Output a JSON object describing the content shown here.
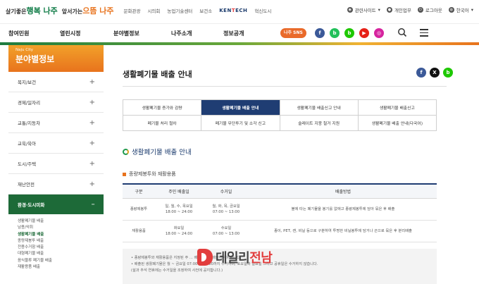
{
  "header": {
    "logo": {
      "part1": "살기좋은",
      "part2": "행복 나주",
      "part3": "앞서가는",
      "part4": "으뜸 나주"
    },
    "links": [
      "문화관광",
      "시의회",
      "농업기술센터",
      "보건소"
    ],
    "kentech": "KENTECH",
    "links2": [
      "혁신도시"
    ],
    "utils": [
      "관련사이트",
      "개인업무",
      "로그아웃",
      "한국어"
    ]
  },
  "nav": {
    "menus": [
      "참여민원",
      "열린시정",
      "분야별정보",
      "나주소개",
      "정보공개"
    ],
    "sns_label": "나주 SNS",
    "sns_icons": [
      {
        "name": "facebook-icon",
        "glyph": "f",
        "color": "#3b5998"
      },
      {
        "name": "band-icon",
        "glyph": "b",
        "color": "#21c05a"
      },
      {
        "name": "blog-icon",
        "glyph": "b",
        "color": "#1ec800"
      },
      {
        "name": "youtube-icon",
        "glyph": "▶",
        "color": "#e62117"
      },
      {
        "name": "instagram-icon",
        "glyph": "◎",
        "color": "#d6249f"
      },
      {
        "name": "kakaostory-icon",
        "glyph": "●",
        "color": "#f5c300"
      }
    ]
  },
  "sidebar": {
    "subtitle": "Naju City",
    "title": "분야별정보",
    "items": [
      "복지/보건",
      "경제/일자리",
      "교통/지동차",
      "교육/육아",
      "도시/주택",
      "재난안전"
    ],
    "active": "환경·도시미화",
    "subitems": [
      "생활폐기물 배출",
      "남용/악취",
      "생활폐기물 배출",
      "종량제봉투 배출",
      "전용수거함 배출",
      "대형폐기물 배출",
      "음식물류 폐기물 배출",
      "재활용품 배출"
    ]
  },
  "content": {
    "page_title": "생활폐기물 배출 안내",
    "share_icons": [
      {
        "name": "share-facebook-icon",
        "glyph": "f",
        "color": "#3b5998"
      },
      {
        "name": "share-x-icon",
        "glyph": "X",
        "color": "#111111"
      },
      {
        "name": "share-blog-icon",
        "glyph": "b",
        "color": "#1ec800"
      }
    ],
    "tabs": [
      "생활폐기물 증가와 감량",
      "생활폐기물 배출 안내",
      "생활폐기물 배출신고 안내",
      "생활폐기물 배출신고",
      "폐기물 처리 절차",
      "폐기물 무단투기 및 소각 신고",
      "슬레이트 지붕 철거 지원",
      "생활폐기물 배출 안내(다국어)"
    ],
    "section_title": "생활폐기물 배출 안내",
    "sub_title": "종량제봉투와 재활용품",
    "table": {
      "headers": [
        "구분",
        "주민 배출일",
        "수거일",
        "배출방법"
      ],
      "rows": [
        {
          "type": "종량제봉투",
          "day1": "일, 월, 수, 목요일",
          "time1": "18:00 ~ 24:00",
          "day2": "월, 화, 목, 금요일",
          "time2": "07:00 ~ 13:00",
          "method": "불에 타는 폐기물을 봉기를 없애고 종량제봉투에 담아 묶은 후 배출"
        },
        {
          "type": "재활용품",
          "day1": "화요일",
          "time1": "18:00 ~ 24:00",
          "day2": "수요일",
          "time2": "07:00 ~ 13:00",
          "method": "종이, PET, 캔, 비닐 등으로 구분하여 투명한 비닐봉투에 담거나 끈으로 묶은 후 분리배출"
        }
      ]
    },
    "notes": [
      "• 종량제봉투와 재활용품은 지정된 주 ... 배출장소에 배출하여야 합니다.",
      "• 배출된 생활폐기물은 월 ~ 금요일 07:00 ~ 13:00까지 수거하며, 토요일과 일요일 그리고 공휴일은 수거하지 않습니다.",
      "(설과 추석 연휴에는 수거일을 조정하여 사전에 공지합니다.)"
    ]
  },
  "watermark": {
    "part1": "데일리",
    "part2": "전남"
  }
}
